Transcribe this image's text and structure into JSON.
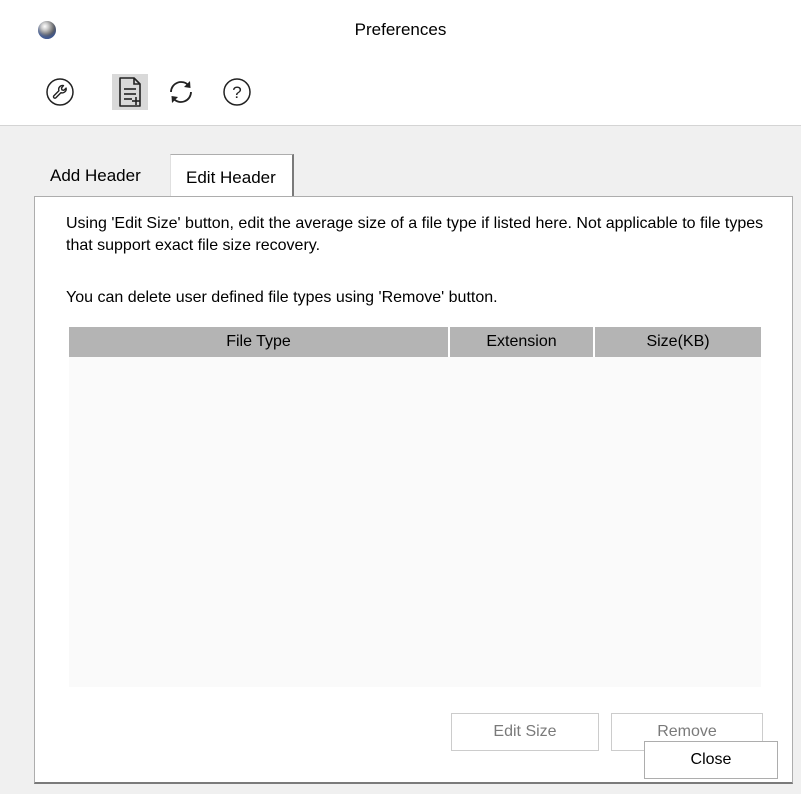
{
  "window": {
    "title": "Preferences"
  },
  "toolbar": {
    "buttons": [
      {
        "icon": "wrench-icon",
        "selected": false
      },
      {
        "icon": "document-edit-icon",
        "selected": true
      },
      {
        "icon": "refresh-icon",
        "selected": false
      },
      {
        "icon": "help-icon",
        "selected": false
      }
    ]
  },
  "tabs": [
    {
      "label": "Add Header",
      "active": false
    },
    {
      "label": "Edit Header",
      "active": true
    }
  ],
  "edit_header": {
    "description_1": "Using 'Edit Size' button, edit the average size of a file type if listed here. Not applicable to file types that support exact file size recovery.",
    "description_2": "You can delete user defined file types using 'Remove' button.",
    "table": {
      "columns": [
        "File Type",
        "Extension",
        "Size(KB)"
      ],
      "rows": []
    },
    "edit_size_label": "Edit Size",
    "remove_label": "Remove"
  },
  "footer": {
    "close_label": "Close"
  },
  "colors": {
    "content_background": "#f0f0f0",
    "table_header": "#b4b4b4",
    "selected_tool": "#d9d9d9",
    "disabled_text": "#7a7a7a"
  }
}
